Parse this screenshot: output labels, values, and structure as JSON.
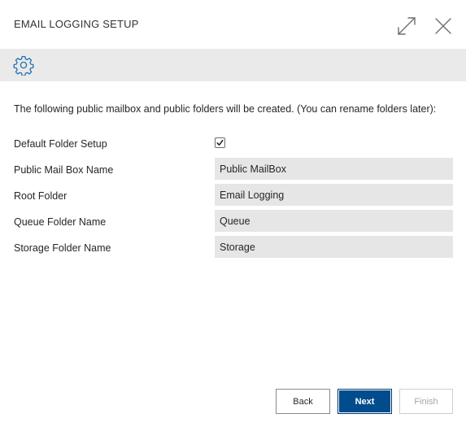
{
  "dialog": {
    "title": "EMAIL LOGGING SETUP"
  },
  "toolbar": {
    "icon": "gear-icon"
  },
  "intro": {
    "text": "The following public mailbox and public folders will be created. (You can rename folders later):"
  },
  "fields": {
    "default_folder_setup": {
      "label": "Default Folder Setup",
      "checked": true
    },
    "public_mailbox_name": {
      "label": "Public Mail Box Name",
      "value": "Public MailBox"
    },
    "root_folder": {
      "label": "Root Folder",
      "value": "Email Logging"
    },
    "queue_folder_name": {
      "label": "Queue Folder Name",
      "value": "Queue"
    },
    "storage_folder_name": {
      "label": "Storage Folder Name",
      "value": "Storage"
    }
  },
  "buttons": {
    "back": "Back",
    "next": "Next",
    "finish": "Finish"
  },
  "colors": {
    "accent": "#004c8c",
    "toolbar_bg": "#eaeaea",
    "field_bg": "#e6e6e6",
    "icon": "#1f6fb5"
  }
}
